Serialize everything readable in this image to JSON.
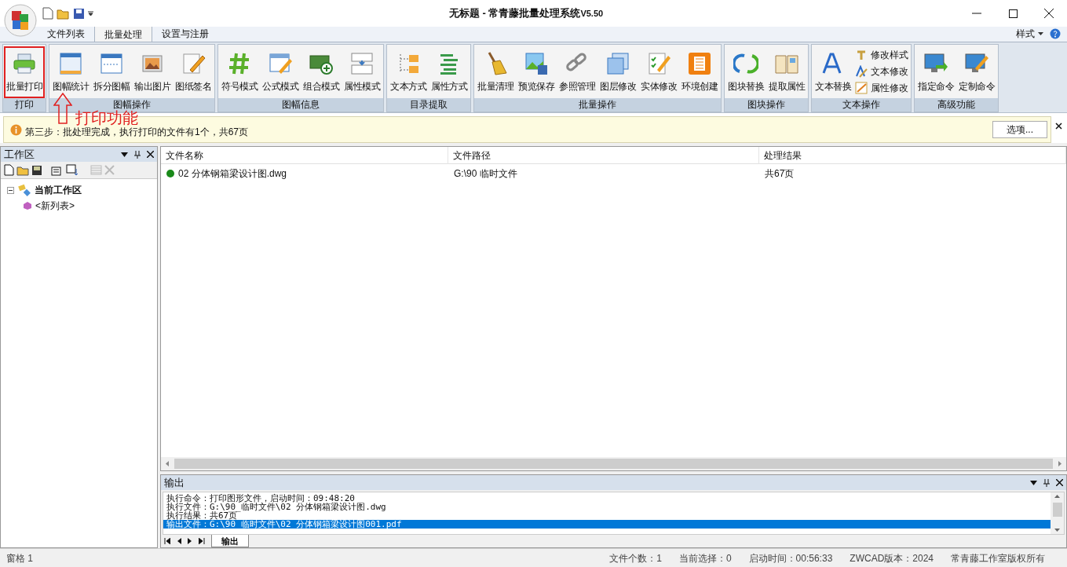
{
  "window": {
    "title": "无标题 - 常青藤批量处理系统",
    "version": "V5.50"
  },
  "menu_tabs": [
    {
      "label": "文件列表",
      "selected": false
    },
    {
      "label": "批量处理",
      "selected": true
    },
    {
      "label": "设置与注册",
      "selected": false
    }
  ],
  "style_menu": "样式",
  "ribbon_groups": [
    {
      "title": "打印",
      "items": [
        {
          "kind": "large",
          "label": "批量打印",
          "highlighted": true
        }
      ]
    },
    {
      "title": "图幅操作",
      "items": [
        {
          "kind": "large",
          "label": "图幅统计",
          "highlighted": false
        },
        {
          "kind": "large",
          "label": "拆分图幅",
          "highlighted": false
        },
        {
          "kind": "large",
          "label": "输出图片",
          "highlighted": false
        },
        {
          "kind": "large",
          "label": "图纸签名",
          "highlighted": false
        }
      ]
    },
    {
      "title": "图幅信息",
      "items": [
        {
          "kind": "large",
          "label": "符号模式",
          "highlighted": false
        },
        {
          "kind": "large",
          "label": "公式模式",
          "highlighted": false
        },
        {
          "kind": "large",
          "label": "组合模式",
          "highlighted": false
        },
        {
          "kind": "large",
          "label": "属性模式",
          "highlighted": false
        }
      ]
    },
    {
      "title": "目录提取",
      "items": [
        {
          "kind": "large",
          "label": "文本方式",
          "highlighted": false
        },
        {
          "kind": "large",
          "label": "属性方式",
          "highlighted": false
        }
      ]
    },
    {
      "title": "批量操作",
      "items": [
        {
          "kind": "large",
          "label": "批量清理",
          "highlighted": false
        },
        {
          "kind": "large",
          "label": "预览保存",
          "highlighted": false
        },
        {
          "kind": "large",
          "label": "参照管理",
          "highlighted": false
        },
        {
          "kind": "large",
          "label": "图层修改",
          "highlighted": false
        },
        {
          "kind": "large",
          "label": "实体修改",
          "highlighted": false
        },
        {
          "kind": "large",
          "label": "环境创建",
          "highlighted": false
        }
      ]
    },
    {
      "title": "图块操作",
      "items": [
        {
          "kind": "large",
          "label": "图块替换",
          "highlighted": false
        },
        {
          "kind": "large",
          "label": "提取属性",
          "highlighted": false
        }
      ]
    },
    {
      "title": "文本操作",
      "items": [
        {
          "kind": "large",
          "label": "文本替换",
          "highlighted": false
        },
        {
          "kind": "small",
          "label": "修改样式",
          "highlighted": false
        },
        {
          "kind": "small",
          "label": "文本修改",
          "highlighted": false
        },
        {
          "kind": "small",
          "label": "属性修改",
          "highlighted": false
        }
      ]
    },
    {
      "title": "高级功能",
      "items": [
        {
          "kind": "large",
          "label": "指定命令",
          "highlighted": false
        },
        {
          "kind": "large",
          "label": "定制命令",
          "highlighted": false
        }
      ]
    }
  ],
  "annotation": "打印功能",
  "info_bar": {
    "message": "第三步：批处理完成，执行打印的文件有1个，共67页",
    "button": "选项..."
  },
  "workspace": {
    "title": "工作区",
    "tree": [
      {
        "label": "当前工作区",
        "expanded": true,
        "children": [
          {
            "label": "<新列表>"
          }
        ]
      }
    ]
  },
  "table": {
    "columns": [
      "文件名称",
      "文件路径",
      "处理结果"
    ],
    "rows": [
      {
        "color": "#1a8a1a",
        "cells": [
          "02 分体钢箱梁设计图.dwg",
          "G:\\90 临时文件",
          "共67页"
        ]
      }
    ]
  },
  "output": {
    "title": "输出",
    "lines": [
      {
        "text": "执行命令：打印图形文件，启动时间：09:48:20",
        "selected": false
      },
      {
        "text": "执行文件：G:\\90_临时文件\\02 分体钢箱梁设计图.dwg",
        "selected": false
      },
      {
        "text": "执行结果：共67页",
        "selected": false
      },
      {
        "text": "输出文件：G:\\90 临时文件\\02 分体钢箱梁设计图001.pdf",
        "selected": true
      }
    ],
    "tabs": [
      {
        "label": "输出",
        "selected": true
      }
    ]
  },
  "status_bar": {
    "left": "窗格 1",
    "items": [
      "文件个数：1",
      "当前选择：0",
      "启动时间：00:56:33",
      "ZWCAD版本：2024",
      "常青藤工作室版权所有"
    ]
  }
}
